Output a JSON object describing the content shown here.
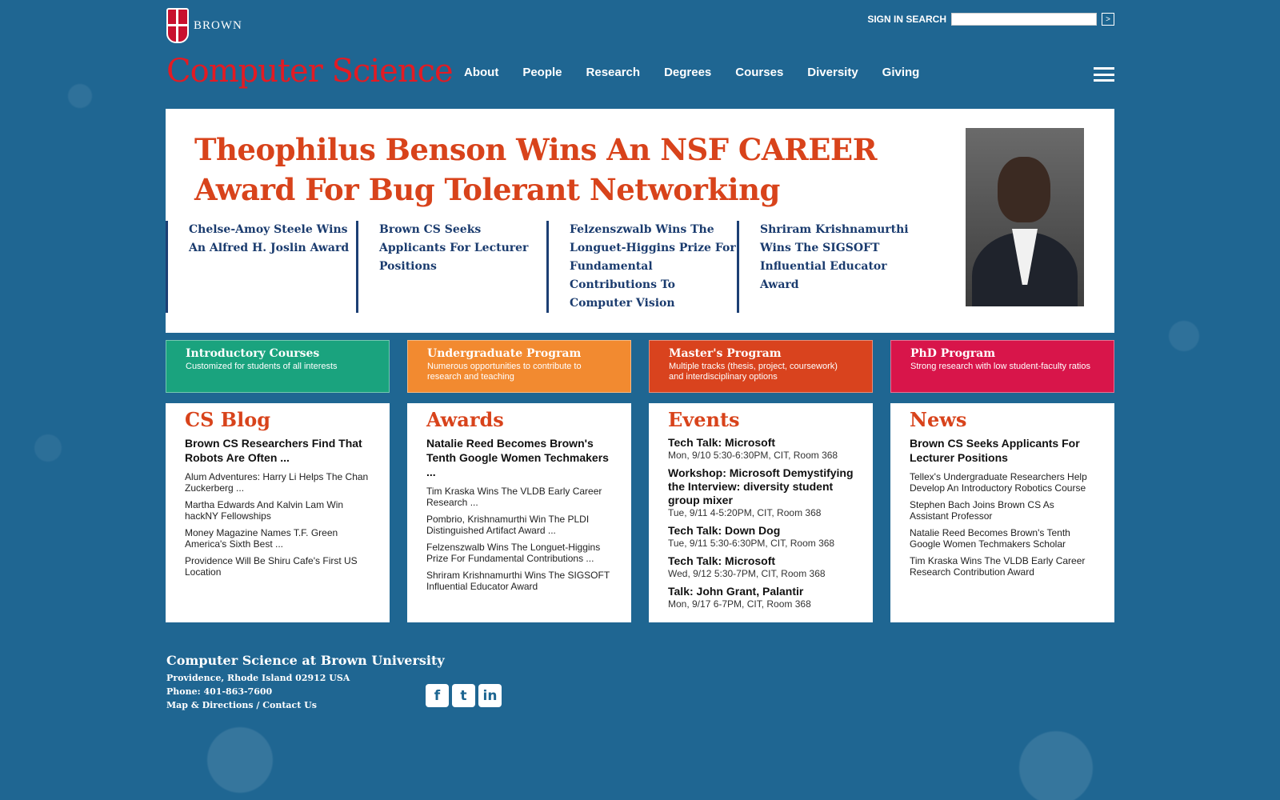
{
  "header": {
    "brand": "BROWN",
    "site_title": "Computer Science",
    "utility_links": "SIGN IN SEARCH",
    "search_go": ">",
    "nav": [
      "About",
      "People",
      "Research",
      "Degrees",
      "Courses",
      "Diversity",
      "Giving"
    ]
  },
  "hero": {
    "headline": "Theophilus Benson Wins An NSF CAREER Award For Bug Tolerant Networking",
    "stories": [
      "Chelse-Amoy Steele Wins An Alfred H. Joslin Award",
      "Brown CS Seeks Applicants For Lecturer Positions",
      "Felzenszwalb Wins The Longuet-Higgins Prize For Fundamental Contributions To Computer Vision",
      "Shriram Krishnamurthi Wins The SIGSOFT Influential Educator Award"
    ]
  },
  "programs": [
    {
      "title": "Introductory Courses",
      "desc": "Customized for students of all interests",
      "color": "#1aa37e"
    },
    {
      "title": "Undergraduate Program",
      "desc": "Numerous opportunities to contribute to research and teaching",
      "color": "#f28a30"
    },
    {
      "title": "Master's Program",
      "desc": "Multiple tracks (thesis, project, coursework) and interdisciplinary options",
      "color": "#d9431e"
    },
    {
      "title": "PhD Program",
      "desc": "Strong research with low student-faculty ratios",
      "color": "#d8154a"
    }
  ],
  "blog": {
    "heading": "CS Blog",
    "lead": "Brown CS Researchers Find That Robots Are Often ...",
    "items": [
      "Alum Adventures: Harry Li Helps The Chan Zuckerberg ...",
      "Martha Edwards And Kalvin Lam Win hackNY Fellowships",
      "Money Magazine Names T.F. Green America's Sixth Best ...",
      "Providence Will Be Shiru Cafe's First US Location"
    ]
  },
  "awards": {
    "heading": "Awards",
    "lead": "Natalie Reed Becomes Brown's Tenth Google Women Techmakers ...",
    "items": [
      "Tim Kraska Wins The VLDB Early Career Research ...",
      "Pombrio, Krishnamurthi Win The PLDI Distinguished Artifact Award ...",
      "Felzenszwalb Wins The Longuet-Higgins Prize For Fundamental Contributions ...",
      "Shriram Krishnamurthi Wins The SIGSOFT Influential Educator Award"
    ]
  },
  "events": {
    "heading": "Events",
    "items": [
      {
        "title": "Tech Talk: Microsoft",
        "date": "Mon, 9/10 5:30-6:30PM, CIT, Room 368"
      },
      {
        "title": "Workshop: Microsoft Demystifying the Interview: diversity student group mixer",
        "date": "Tue, 9/11 4-5:20PM, CIT, Room 368"
      },
      {
        "title": "Tech Talk: Down Dog",
        "date": "Tue, 9/11 5:30-6:30PM, CIT, Room 368"
      },
      {
        "title": "Tech Talk: Microsoft",
        "date": "Wed, 9/12 5:30-7PM, CIT, Room 368"
      },
      {
        "title": "Talk: John Grant, Palantir",
        "date": "Mon, 9/17 6-7PM, CIT, Room 368"
      }
    ]
  },
  "news": {
    "heading": "News",
    "lead": "Brown CS Seeks Applicants For Lecturer Positions",
    "items": [
      "Tellex's Undergraduate Researchers Help Develop An Introductory Robotics Course",
      "Stephen Bach Joins Brown CS As Assistant Professor",
      "Natalie Reed Becomes Brown's Tenth Google Women Techmakers Scholar",
      "Tim Kraska Wins The VLDB Early Career Research Contribution Award"
    ]
  },
  "footer": {
    "name": "Computer Science at Brown University",
    "address": "Providence, Rhode Island 02912 USA",
    "phone": "Phone: 401-863-7600",
    "links": "Map & Directions / Contact Us",
    "social": [
      {
        "icon": "facebook-icon",
        "glyph": "f"
      },
      {
        "icon": "twitter-icon",
        "glyph": "t"
      },
      {
        "icon": "linkedin-icon",
        "glyph": "in"
      }
    ]
  }
}
